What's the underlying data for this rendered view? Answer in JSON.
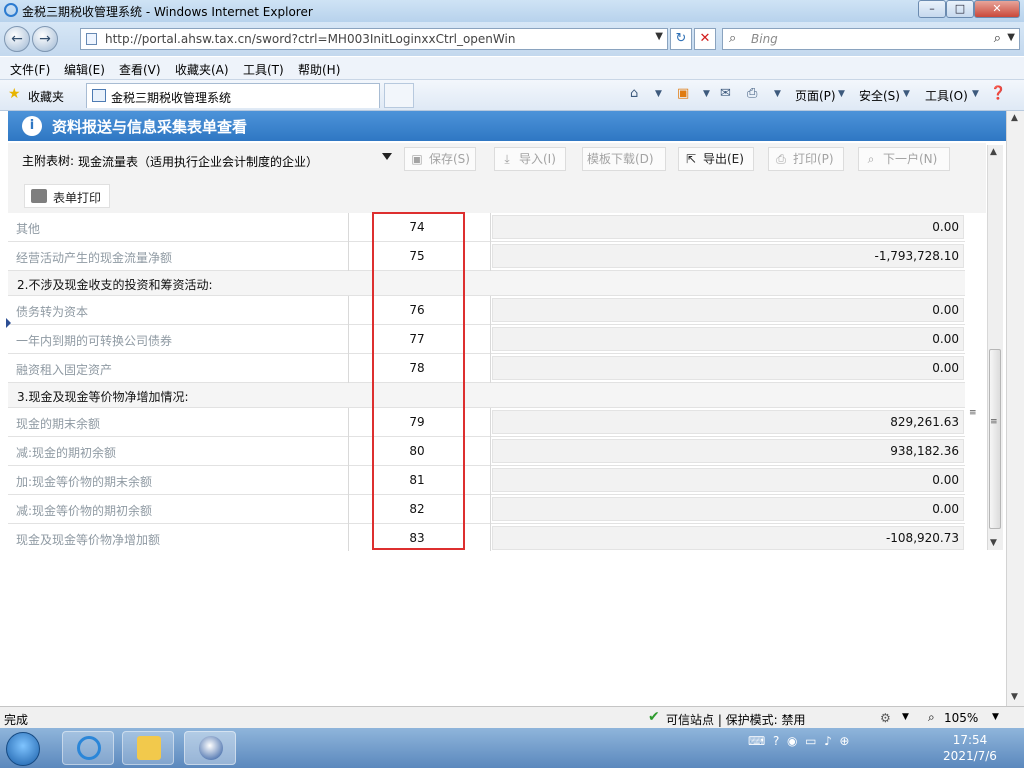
{
  "window": {
    "title": "金税三期税收管理系统 - Windows Internet Explorer",
    "min": "–",
    "max": "□",
    "close": "✕"
  },
  "address": {
    "url": "http://portal.ahsw.tax.cn/sword?ctrl=MH003InitLoginxxCtrl_openWin",
    "search_placeholder": "Bing",
    "back": "←",
    "forward": "→"
  },
  "menu": [
    "文件(F)",
    "编辑(E)",
    "查看(V)",
    "收藏夹(A)",
    "工具(T)",
    "帮助(H)"
  ],
  "favbar": {
    "favorites": "收藏夹",
    "tab_title": "金税三期税收管理系统",
    "page": "页面(P)",
    "safety": "安全(S)",
    "tools": "工具(O)"
  },
  "panel": {
    "title": "资料报送与信息采集表单查看",
    "main_table_label": "主附表树:",
    "main_table_value": "现金流量表（适用执行企业会计制度的企业）",
    "buttons": {
      "save": "保存(S)",
      "import": "导入(I)",
      "template": "模板下载(D)",
      "export": "导出(E)",
      "print": "打印(P)",
      "next": "下一户(N)"
    },
    "form_print": "表单打印"
  },
  "rows": [
    {
      "type": "item",
      "name": "其他",
      "no": "74",
      "amount": "0.00"
    },
    {
      "type": "item",
      "name": "经营活动产生的现金流量净额",
      "no": "75",
      "amount": "-1,793,728.10"
    },
    {
      "type": "section",
      "name": "2.不涉及现金收支的投资和筹资活动:"
    },
    {
      "type": "item",
      "name": "债务转为资本",
      "no": "76",
      "amount": "0.00"
    },
    {
      "type": "item",
      "name": "一年内到期的可转换公司债券",
      "no": "77",
      "amount": "0.00"
    },
    {
      "type": "item",
      "name": "融资租入固定资产",
      "no": "78",
      "amount": "0.00"
    },
    {
      "type": "section",
      "name": "3.现金及现金等价物净增加情况:"
    },
    {
      "type": "item",
      "name": "现金的期末余额",
      "no": "79",
      "amount": "829,261.63"
    },
    {
      "type": "item",
      "name": "减:现金的期初余额",
      "no": "80",
      "amount": "938,182.36"
    },
    {
      "type": "item",
      "name": "加:现金等价物的期末余额",
      "no": "81",
      "amount": "0.00"
    },
    {
      "type": "item",
      "name": "减:现金等价物的期初余额",
      "no": "82",
      "amount": "0.00"
    },
    {
      "type": "item",
      "name": "现金及现金等价物净增加额",
      "no": "83",
      "amount": "-108,920.73"
    }
  ],
  "status": {
    "done": "完成",
    "security": "可信站点 | 保护模式: 禁用",
    "zoom": "105%"
  },
  "taskbar": {
    "time": "17:54",
    "date": "2021/7/6"
  },
  "colors": {
    "accent": "#2f77c3",
    "highlight_box": "#dd2f2f"
  }
}
